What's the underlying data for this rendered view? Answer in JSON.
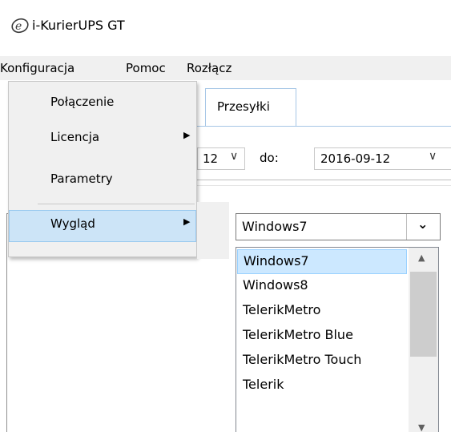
{
  "window": {
    "title": "i-KurierUPS GT",
    "icon": "e-logo-icon"
  },
  "menubar": {
    "items": [
      "Konfiguracja",
      "Pomoc",
      "Rozłącz"
    ]
  },
  "tabs": {
    "active": "Przesyłki"
  },
  "filters": {
    "from_fragment": "12",
    "to_label": "do:",
    "to_value": "2016-09-12"
  },
  "config_menu": {
    "items": [
      {
        "label": "Połączenie",
        "has_submenu": false
      },
      {
        "label": "Licencja",
        "has_submenu": true
      },
      {
        "label": "Parametry",
        "has_submenu": false
      },
      {
        "label": "Wygląd",
        "has_submenu": true,
        "highlighted": true
      }
    ]
  },
  "theme_combo": {
    "selected": "Windows7",
    "options": [
      "Windows7",
      "Windows8",
      "TelerikMetro",
      "TelerikMetro Blue",
      "TelerikMetro Touch",
      "Telerik"
    ]
  },
  "colors": {
    "highlight": "#cce4f7",
    "menu_bg": "#f0f0f0",
    "tab_border": "#a6c6e6"
  }
}
